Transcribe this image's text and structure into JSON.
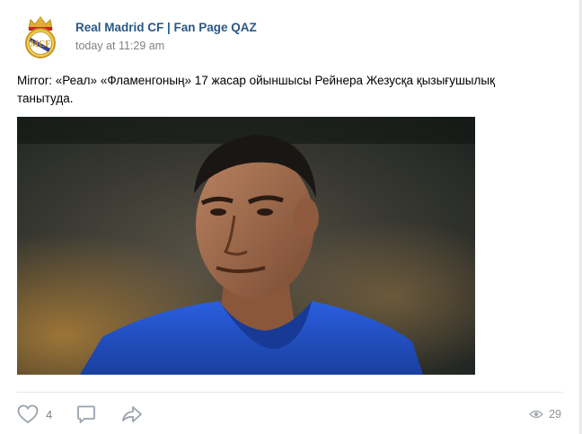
{
  "post": {
    "author": "Real Madrid CF | Fan Page QAZ",
    "time": "today at 11:29 am",
    "text": "Mirror: «Реал» «Фламенгоның» 17 жасар ойыншысы Рейнера Жезусқа қызығушылық танытуда."
  },
  "actions": {
    "likes": "4",
    "views": "29"
  },
  "colors": {
    "author_link": "#2a5885",
    "meta_text": "#828282",
    "icon": "#99a2ad",
    "jersey_blue": "#1f4fc8"
  },
  "icons": {
    "like": "heart-icon",
    "comment": "comment-icon",
    "share": "share-arrow-icon",
    "views": "eye-icon"
  }
}
